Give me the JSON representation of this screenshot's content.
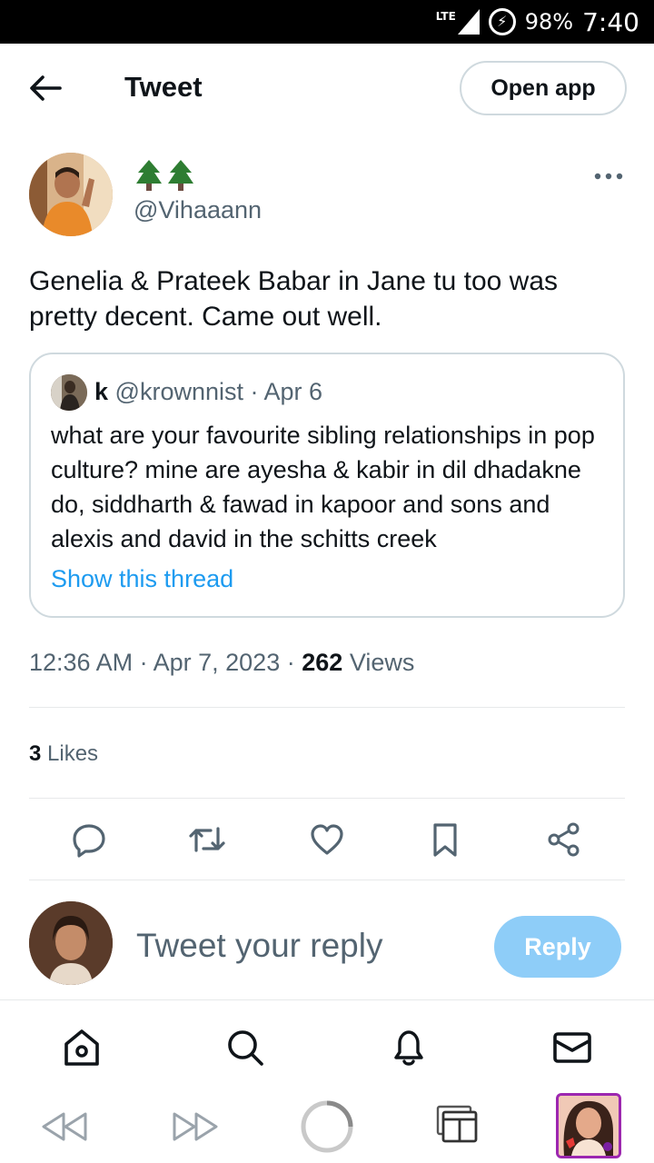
{
  "status_bar": {
    "network": "LTE",
    "battery": "98%",
    "time": "7:40"
  },
  "header": {
    "title": "Tweet",
    "open_app_label": "Open app",
    "back_icon": "arrow-left-icon"
  },
  "tweet": {
    "author_name": "🌲🌲",
    "author_handle": "@Vihaaann",
    "text": "Genelia & Prateek Babar in Jane tu too was pretty decent. Came out well.",
    "quote": {
      "name": "k",
      "handle": "@krownnist",
      "separator": "·",
      "date": "Apr 6",
      "text": "what are your favourite sibling relationships in pop culture? mine are ayesha & kabir in dil dhadakne do, siddharth & fawad in kapoor and sons and alexis and david in the schitts creek",
      "show_thread": "Show this thread"
    },
    "time": "12:36 AM",
    "separator": "·",
    "date": "Apr 7, 2023",
    "views_count": "262",
    "views_label": "Views",
    "likes_count": "3",
    "likes_label": "Likes"
  },
  "actions": [
    "reply-icon",
    "retweet-icon",
    "like-icon",
    "bookmark-icon",
    "share-icon"
  ],
  "reply": {
    "placeholder": "Tweet your reply",
    "button_label": "Reply"
  },
  "bottom_nav": [
    "home-icon",
    "search-icon",
    "notifications-icon",
    "messages-icon"
  ],
  "colors": {
    "accent": "#1d9bf0",
    "reply_button_disabled": "#8ecdf8",
    "secondary_text": "#536471",
    "border": "#cfd9de",
    "status_bar": "#000000",
    "tab_thumb_border": "#9c27b0"
  }
}
